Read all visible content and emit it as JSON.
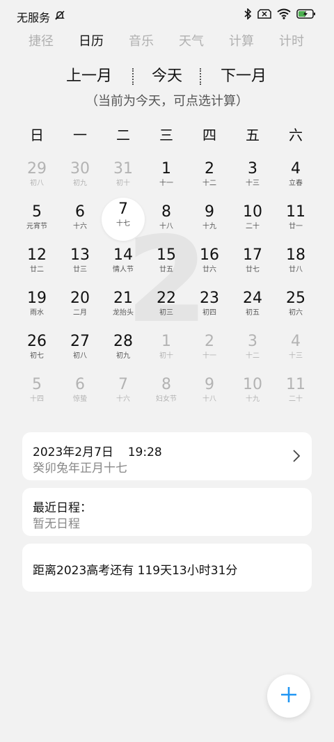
{
  "status": {
    "carrier": "无服务",
    "icons": [
      "mute-icon",
      "bluetooth-icon",
      "sim-none-icon",
      "wifi-icon",
      "battery-charging-icon"
    ]
  },
  "tabs": [
    "捷径",
    "日历",
    "音乐",
    "天气",
    "计算",
    "计时"
  ],
  "active_tab": "日历",
  "nav": {
    "prev": "上一月",
    "today": "今天",
    "next": "下一月"
  },
  "hint": "（当前为今天，可点选计算）",
  "weekdays": [
    "日",
    "一",
    "二",
    "三",
    "四",
    "五",
    "六"
  ],
  "background_month": "2",
  "calendar": {
    "weeks": [
      [
        {
          "d": "29",
          "l": "初八",
          "other": true
        },
        {
          "d": "30",
          "l": "初九",
          "other": true
        },
        {
          "d": "31",
          "l": "初十",
          "other": true
        },
        {
          "d": "1",
          "l": "十一"
        },
        {
          "d": "2",
          "l": "十二"
        },
        {
          "d": "3",
          "l": "十三"
        },
        {
          "d": "4",
          "l": "立春"
        }
      ],
      [
        {
          "d": "5",
          "l": "元宵节"
        },
        {
          "d": "6",
          "l": "十六"
        },
        {
          "d": "7",
          "l": "十七",
          "today": true
        },
        {
          "d": "8",
          "l": "十八"
        },
        {
          "d": "9",
          "l": "十九"
        },
        {
          "d": "10",
          "l": "二十"
        },
        {
          "d": "11",
          "l": "廿一"
        }
      ],
      [
        {
          "d": "12",
          "l": "廿二"
        },
        {
          "d": "13",
          "l": "廿三"
        },
        {
          "d": "14",
          "l": "情人节"
        },
        {
          "d": "15",
          "l": "廿五"
        },
        {
          "d": "16",
          "l": "廿六"
        },
        {
          "d": "17",
          "l": "廿七"
        },
        {
          "d": "18",
          "l": "廿八"
        }
      ],
      [
        {
          "d": "19",
          "l": "雨水"
        },
        {
          "d": "20",
          "l": "二月"
        },
        {
          "d": "21",
          "l": "龙抬头"
        },
        {
          "d": "22",
          "l": "初三"
        },
        {
          "d": "23",
          "l": "初四"
        },
        {
          "d": "24",
          "l": "初五"
        },
        {
          "d": "25",
          "l": "初六"
        }
      ],
      [
        {
          "d": "26",
          "l": "初七"
        },
        {
          "d": "27",
          "l": "初八"
        },
        {
          "d": "28",
          "l": "初九"
        },
        {
          "d": "1",
          "l": "初十",
          "other": true
        },
        {
          "d": "2",
          "l": "十一",
          "other": true
        },
        {
          "d": "3",
          "l": "十二",
          "other": true
        },
        {
          "d": "4",
          "l": "十三",
          "other": true
        }
      ],
      [
        {
          "d": "5",
          "l": "十四",
          "other": true
        },
        {
          "d": "6",
          "l": "惊蛰",
          "other": true
        },
        {
          "d": "7",
          "l": "十六",
          "other": true
        },
        {
          "d": "8",
          "l": "妇女节",
          "other": true
        },
        {
          "d": "9",
          "l": "十八",
          "other": true
        },
        {
          "d": "10",
          "l": "十九",
          "other": true
        },
        {
          "d": "11",
          "l": "二十",
          "other": true
        }
      ]
    ]
  },
  "cards": {
    "datetime": {
      "date": "2023年2月7日",
      "time": "19:28",
      "lunar": "癸卯兔年正月十七"
    },
    "schedule": {
      "title": "最近日程：",
      "empty": "暂无日程"
    },
    "countdown": {
      "text": "距离2023高考还有 119天13小时31分"
    }
  },
  "fab_icon": "plus-icon",
  "colors": {
    "accent": "#2196f3",
    "background": "#f2f2f2",
    "muted": "#b3b3b3"
  }
}
